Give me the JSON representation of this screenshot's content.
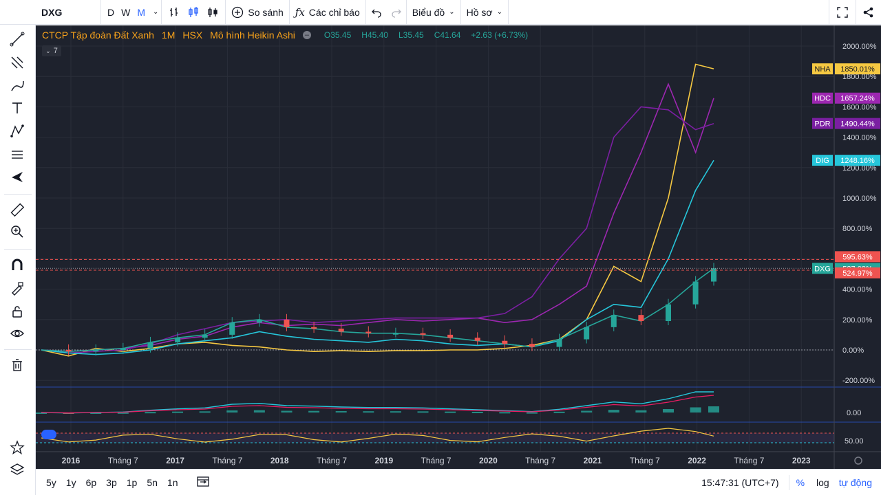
{
  "toolbar": {
    "symbol": "DXG",
    "intervals": [
      "D",
      "W",
      "M"
    ],
    "active_interval": "M",
    "compare_label": "So sánh",
    "indicators_label": "Các chỉ báo",
    "chart_type_label": "Biểu đồ",
    "profile_label": "Hồ sơ"
  },
  "legend": {
    "name": "CTCP Tập đoàn Đất Xanh",
    "interval": "1M",
    "exchange": "HSX",
    "style": "Mô hình Heikin Ashi",
    "o": "O35.45",
    "h": "H45.40",
    "l": "L35.45",
    "c": "C41.64",
    "change": "+2.63 (+6.73%)",
    "collapsed_count": "7"
  },
  "price_axis": {
    "labels": [
      "2000.00%",
      "1800.00%",
      "1600.00%",
      "1400.00%",
      "1200.00%",
      "1000.00%",
      "800.00%",
      "600.00%",
      "400.00%",
      "200.00%",
      "0.00%",
      "-200.00%"
    ],
    "macd_label": "0.00",
    "rsi_label": "50.00"
  },
  "badges": [
    {
      "label": "NHA",
      "value": "1850.01%",
      "color": "#f5c842",
      "pct": 1850.01
    },
    {
      "label": "HDC",
      "value": "1657.24%",
      "color": "#9c27b0",
      "pct": 1657.24
    },
    {
      "label": "PDR",
      "value": "1490.44%",
      "color": "#7b1fa2",
      "pct": 1490.44
    },
    {
      "label": "DIG",
      "value": "1248.16%",
      "color": "#26c6da",
      "pct": 1248.16
    },
    {
      "label": "",
      "value": "595.63%",
      "color": "#ef5350",
      "pct": 595.63
    },
    {
      "label": "DXG",
      "value": "537.08%",
      "color": "#26a69a",
      "pct": 537.08
    },
    {
      "label": "",
      "value": "524.97%",
      "color": "#ef5350",
      "pct": 524.97
    }
  ],
  "time_axis": [
    "2016",
    "Tháng 7",
    "2017",
    "Tháng 7",
    "2018",
    "Tháng 7",
    "2019",
    "Tháng 7",
    "2020",
    "Tháng 7",
    "2021",
    "Tháng 7",
    "2022",
    "Tháng 7",
    "2023"
  ],
  "bottom": {
    "ranges": [
      "5y",
      "1y",
      "6p",
      "3p",
      "1p",
      "5n",
      "1n"
    ],
    "clock": "15:47:31 (UTC+7)",
    "percent": "%",
    "log": "log",
    "auto": "tự động"
  },
  "chart_data": {
    "type": "line",
    "x": [
      "2016-01",
      "2016-04",
      "2016-07",
      "2016-10",
      "2017-01",
      "2017-04",
      "2017-07",
      "2017-10",
      "2018-01",
      "2018-04",
      "2018-07",
      "2018-10",
      "2019-01",
      "2019-04",
      "2019-07",
      "2019-10",
      "2020-01",
      "2020-04",
      "2020-07",
      "2020-10",
      "2021-01",
      "2021-04",
      "2021-07",
      "2021-10",
      "2022-01",
      "2022-03"
    ],
    "ylim": [
      -200,
      2000
    ],
    "series": [
      {
        "name": "NHA",
        "color": "#f5c842",
        "values": [
          0,
          -40,
          10,
          -10,
          10,
          40,
          50,
          30,
          20,
          0,
          -10,
          -5,
          -10,
          -5,
          -5,
          0,
          0,
          10,
          30,
          70,
          200,
          550,
          450,
          1000,
          1880,
          1850
        ]
      },
      {
        "name": "HDC",
        "color": "#9c27b0",
        "values": [
          0,
          -10,
          0,
          10,
          30,
          70,
          90,
          150,
          180,
          160,
          170,
          160,
          180,
          200,
          190,
          200,
          210,
          180,
          200,
          300,
          420,
          900,
          1300,
          1750,
          1300,
          1657
        ]
      },
      {
        "name": "PDR",
        "color": "#7b1fa2",
        "values": [
          0,
          -20,
          -10,
          0,
          40,
          100,
          140,
          180,
          190,
          200,
          180,
          190,
          200,
          210,
          210,
          210,
          210,
          240,
          350,
          600,
          800,
          1400,
          1600,
          1580,
          1450,
          1490
        ]
      },
      {
        "name": "DIG",
        "color": "#26c6da",
        "values": [
          0,
          -20,
          -30,
          -20,
          0,
          40,
          60,
          80,
          120,
          90,
          70,
          60,
          50,
          70,
          60,
          40,
          30,
          40,
          20,
          60,
          200,
          300,
          280,
          600,
          1050,
          1248
        ]
      },
      {
        "name": "DXG",
        "color": "#26a69a",
        "values": [
          0,
          -10,
          0,
          10,
          50,
          80,
          100,
          180,
          200,
          150,
          140,
          120,
          110,
          110,
          100,
          80,
          60,
          40,
          20,
          70,
          150,
          230,
          190,
          300,
          450,
          537
        ]
      }
    ]
  }
}
